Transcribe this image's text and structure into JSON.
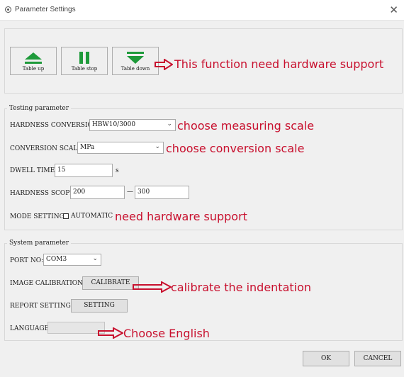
{
  "window": {
    "title": "Parameter Settings",
    "close_glyph": "✕"
  },
  "toolbar": {
    "table_up": "Table up",
    "table_stop": "Table stop",
    "table_down": "Table down"
  },
  "testing": {
    "legend": "Testing parameter",
    "hardness_conversion_label": "HARDNESS CONVERSION:",
    "hardness_conversion_value": "HBW10/3000",
    "conversion_scale_label": "CONVERSION SCALE:",
    "conversion_scale_value": "MPa",
    "dwell_time_label": "DWELL TIME:",
    "dwell_time_value": "15",
    "dwell_time_unit": "s",
    "hardness_scope_label": "HARDNESS SCOPE:",
    "hardness_scope_min": "200",
    "hardness_scope_dash": "—",
    "hardness_scope_max": "300",
    "mode_setting_label": "MODE SETTING:",
    "mode_automatic_label": "AUTOMATIC",
    "mode_automatic_checked": false
  },
  "system": {
    "legend": "System parameter",
    "port_no_label": "PORT NO:",
    "port_no_value": "COM3",
    "image_calibration_label": "IMAGE CALIBRATION:",
    "calibrate_button": "CALIBRATE",
    "report_setting_label": "REPORT SETTING:",
    "setting_button": "SETTING",
    "language_label": "LANGUAGE:",
    "language_value": ""
  },
  "footer": {
    "ok": "OK",
    "cancel": "CANCEL"
  },
  "annotations": {
    "hardware_support": "This function need hardware support",
    "measuring_scale": "choose measuring scale",
    "conversion_scale": "choose conversion scale",
    "mode_hardware": "need hardware support",
    "calibrate": "calibrate the indentation",
    "english": "Choose  English"
  },
  "colors": {
    "annotation": "#c8102e",
    "arrow_icon": "#1e9a3a"
  },
  "icons": [
    "up-arrow-icon",
    "pause-icon",
    "down-arrow-icon",
    "red-arrow-icon",
    "dropdown-arrow-icon",
    "checkbox-icon"
  ]
}
